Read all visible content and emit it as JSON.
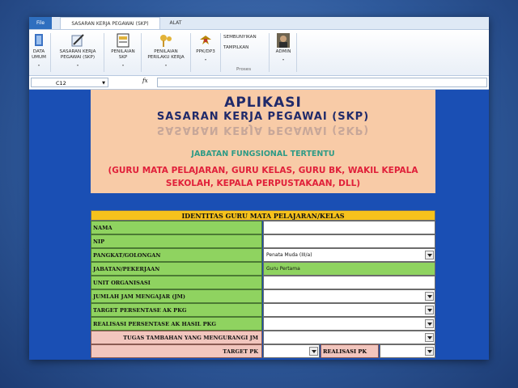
{
  "tabs": {
    "file": "File",
    "active": "SASARAN KERJA PEGAWAI (SKP)",
    "other": "ALAT"
  },
  "ribbon": {
    "buttons": [
      {
        "line1": "DATA",
        "line2": "UMUM",
        "icon": "book-icon"
      },
      {
        "line1": "SASARAN KERJA",
        "line2": "PEGAWAI (SKP)",
        "icon": "pen-document-icon"
      },
      {
        "line1": "PENILAIAN",
        "line2": "SKP",
        "icon": "document-icon"
      },
      {
        "line1": "PENILAIAN",
        "line2": "PERILAKU KERJA",
        "icon": "keys-icon"
      },
      {
        "line1": "PPK/DP3",
        "line2": "",
        "icon": "garuda-icon"
      },
      {
        "line1": "SEMBUNYIKAN",
        "line2": "TAMPILKAN",
        "icon": ""
      },
      {
        "line1": "ADMIN",
        "line2": "",
        "icon": "user-photo-icon"
      }
    ],
    "group_label": "Proses"
  },
  "formula_bar": {
    "cell": "C12",
    "fx": "fx",
    "content": ""
  },
  "banner": {
    "title": "APLIKASI",
    "subtitle": "SASARAN KERJA PEGAWAI (SKP)",
    "jabatan": "JABATAN FUNGSIONAL TERTENTU",
    "desc": "(GURU MATA PELAJARAN, GURU KELAS, GURU BK, WAKIL KEPALA SEKOLAH, KEPALA PERPUSTAKAAN, DLL)"
  },
  "form": {
    "header": "IDENTITAS GURU MATA PELAJARAN/KELAS",
    "rows": [
      {
        "label": "NAMA",
        "value": ""
      },
      {
        "label": "NIP",
        "value": ""
      },
      {
        "label": "PANGKAT/GOLONGAN",
        "value": "Penata Muda (III/a)"
      },
      {
        "label": "JABATAN/PEKERJAAN",
        "value": "Guru Pertama"
      },
      {
        "label": "UNIT ORGANISASI",
        "value": ""
      },
      {
        "label": "JUMLAH JAM MENGAJAR (JM)",
        "value": ""
      },
      {
        "label": "TARGET PERSENTASE AK PKG",
        "value": ""
      },
      {
        "label": "REALISASI PERSENTASE AK HASIL PKG",
        "value": ""
      },
      {
        "label": "TUGAS TAMBAHAN YANG MENGURANGI JM",
        "value": ""
      }
    ],
    "target_pk": "TARGET PK",
    "realisasi_pk": "REALISASI PK"
  }
}
